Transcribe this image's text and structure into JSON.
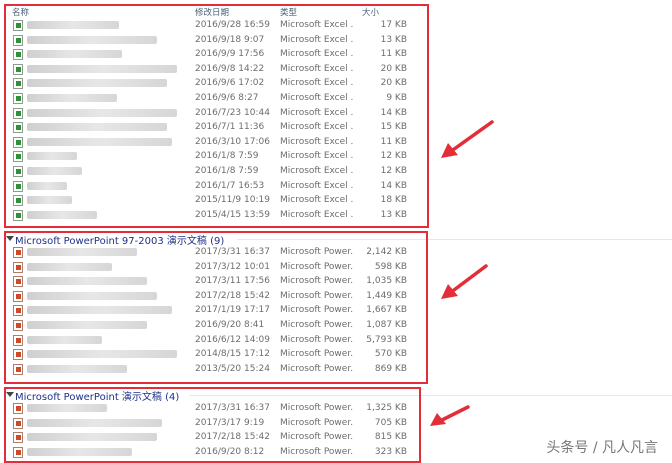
{
  "columns": {
    "name": "名称",
    "date": "修改日期",
    "type": "类型",
    "size": "大小"
  },
  "groups": [
    {
      "title": "",
      "icon": "xls",
      "rows": [
        {
          "date": "2016/9/28 16:59",
          "type": "Microsoft Excel ...",
          "size": "17 KB"
        },
        {
          "date": "2016/9/18 9:07",
          "type": "Microsoft Excel ...",
          "size": "13 KB"
        },
        {
          "date": "2016/9/9 17:56",
          "type": "Microsoft Excel ...",
          "size": "11 KB"
        },
        {
          "date": "2016/9/8 14:22",
          "type": "Microsoft Excel ...",
          "size": "20 KB"
        },
        {
          "date": "2016/9/6 17:02",
          "type": "Microsoft Excel ...",
          "size": "20 KB"
        },
        {
          "date": "2016/9/6 8:27",
          "type": "Microsoft Excel ...",
          "size": "9 KB"
        },
        {
          "date": "2016/7/23 10:44",
          "type": "Microsoft Excel ...",
          "size": "14 KB"
        },
        {
          "date": "2016/7/1 11:36",
          "type": "Microsoft Excel ...",
          "size": "15 KB"
        },
        {
          "date": "2016/3/10 17:06",
          "type": "Microsoft Excel ...",
          "size": "11 KB"
        },
        {
          "date": "2016/1/8 7:59",
          "type": "Microsoft Excel ...",
          "size": "12 KB"
        },
        {
          "date": "2016/1/8 7:59",
          "type": "Microsoft Excel ...",
          "size": "12 KB"
        },
        {
          "date": "2016/1/7 16:53",
          "type": "Microsoft Excel ...",
          "size": "14 KB"
        },
        {
          "date": "2015/11/9 10:19",
          "type": "Microsoft Excel ...",
          "size": "18 KB"
        },
        {
          "date": "2015/4/15 13:59",
          "type": "Microsoft Excel ...",
          "size": "13 KB"
        }
      ]
    },
    {
      "title": "Microsoft PowerPoint 97-2003 演示文稿 (9)",
      "icon": "ppt",
      "rows": [
        {
          "date": "2017/3/31 16:37",
          "type": "Microsoft Power...",
          "size": "2,142 KB"
        },
        {
          "date": "2017/3/12 10:01",
          "type": "Microsoft Power...",
          "size": "598 KB"
        },
        {
          "date": "2017/3/11 17:56",
          "type": "Microsoft Power...",
          "size": "1,035 KB"
        },
        {
          "date": "2017/2/18 15:42",
          "type": "Microsoft Power...",
          "size": "1,449 KB"
        },
        {
          "date": "2017/1/19 17:17",
          "type": "Microsoft Power...",
          "size": "1,667 KB"
        },
        {
          "date": "2016/9/20 8:41",
          "type": "Microsoft Power...",
          "size": "1,087 KB"
        },
        {
          "date": "2016/6/12 14:09",
          "type": "Microsoft Power...",
          "size": "5,793 KB"
        },
        {
          "date": "2014/8/15 17:12",
          "type": "Microsoft Power...",
          "size": "570 KB"
        },
        {
          "date": "2013/5/20 15:24",
          "type": "Microsoft Power...",
          "size": "869 KB"
        }
      ]
    },
    {
      "title": "Microsoft PowerPoint 演示文稿 (4)",
      "icon": "ppt",
      "rows": [
        {
          "date": "2017/3/31 16:37",
          "type": "Microsoft Power...",
          "size": "1,325 KB"
        },
        {
          "date": "2017/3/17 9:19",
          "type": "Microsoft Power...",
          "size": "705 KB"
        },
        {
          "date": "2017/2/18 15:42",
          "type": "Microsoft Power...",
          "size": "815 KB"
        },
        {
          "date": "2016/9/20 8:12",
          "type": "Microsoft Power...",
          "size": "323 KB"
        }
      ]
    }
  ],
  "watermark": "头条号 / 凡人凡言",
  "colors": {
    "highlight": "#e32d38",
    "group_title": "#1e3287"
  }
}
